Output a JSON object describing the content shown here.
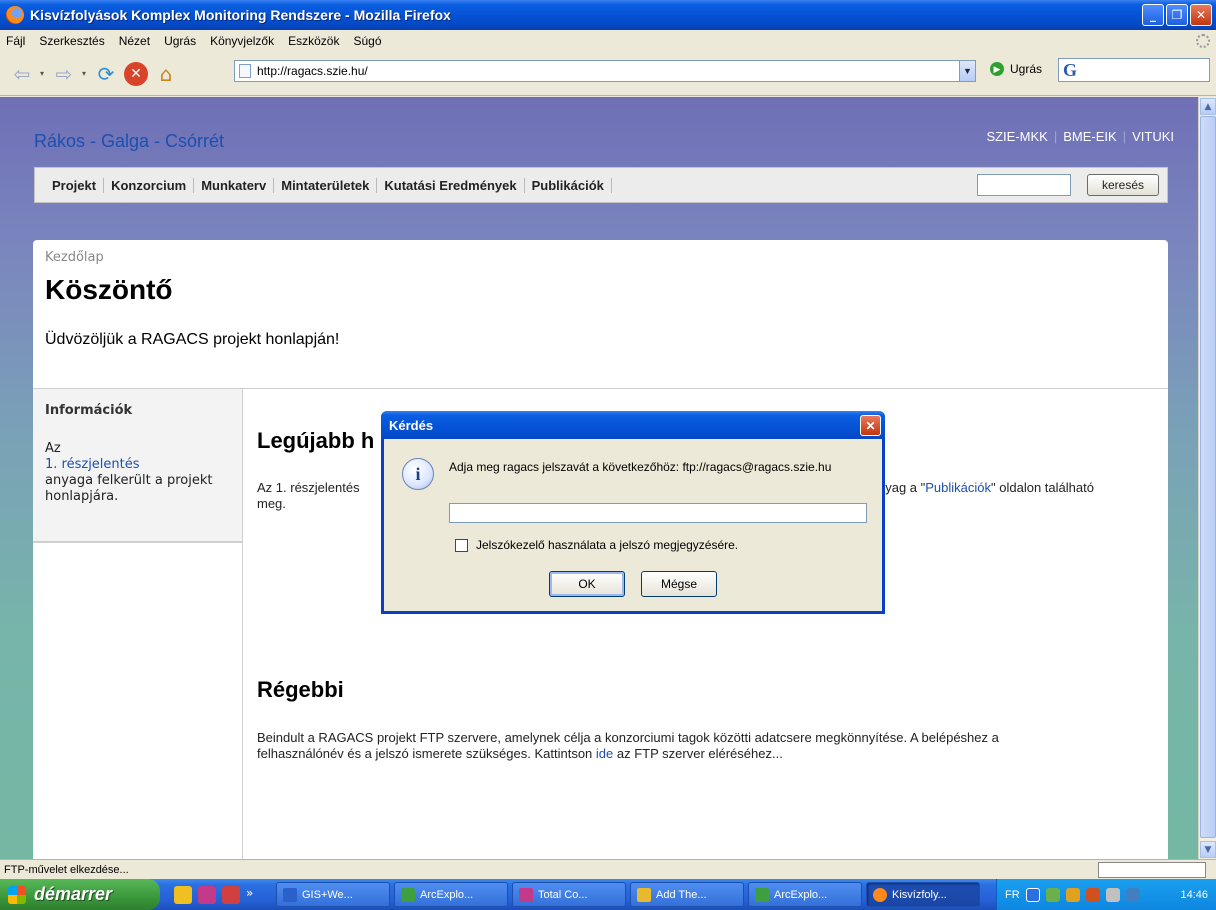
{
  "window": {
    "title": "Kisvízfolyások Komplex Monitoring Rendszere - Mozilla Firefox"
  },
  "menu": [
    "Fájl",
    "Szerkesztés",
    "Nézet",
    "Ugrás",
    "Könyvjelzők",
    "Eszközök",
    "Súgó"
  ],
  "toolbar": {
    "url": "http://ragacs.szie.hu/",
    "go_label": "Ugrás",
    "search_logo": "G"
  },
  "site": {
    "title": "Rákos - Galga - Csórrét",
    "partners": [
      "SZIE-MKK",
      "BME-EIK",
      "VITUKI"
    ],
    "nav": [
      "Projekt",
      "Konzorcium",
      "Munkaterv",
      "Mintaterületek",
      "Kutatási Eredmények",
      "Publikációk"
    ],
    "search_button": "keresés"
  },
  "page": {
    "breadcrumb": "Kezdőlap",
    "heading": "Köszöntő",
    "welcome": "Üdvözöljük a RAGACS projekt honlapján!",
    "sidebar": {
      "title": "Információk",
      "text_before": "Az",
      "link": "1. részjelentés",
      "text_after": "anyaga felkerült a projekt honlapjára."
    },
    "latest": {
      "heading": "Legújabb h",
      "text_start": "Az 1. részjelentés",
      "text_end_pre": "nyag a \"",
      "link": "Publikációk",
      "text_end_post": "\" oldalon található",
      "text_line2": "meg."
    },
    "older": {
      "heading": "Régebbi",
      "text_line1": "Beindult a RAGACS projekt FTP szervere, amelynek célja a konzorciumi tagok közötti adatcsere megkönnyítése. A belépéshez a",
      "text_line2_pre": "felhasználónév és a jelszó ismerete szükséges. Kattintson ",
      "link": "ide",
      "text_line2_post": " az FTP szerver eléréséhez..."
    }
  },
  "dialog": {
    "title": "Kérdés",
    "message": "Adja meg ragacs jelszavát a következőhöz: ftp://ragacs@ragacs.szie.hu",
    "password_value": "",
    "checkbox_label": "Jelszókezelő használata a jelszó megjegyzésére.",
    "checkbox_checked": false,
    "ok": "OK",
    "cancel": "Mégse"
  },
  "status": {
    "text": "FTP-művelet elkezdése..."
  },
  "taskbar": {
    "start": "démarrer",
    "more": "»",
    "tasks": [
      {
        "label": "GIS+We...",
        "color": "#2b5fc9"
      },
      {
        "label": "ArcExplo...",
        "color": "#3f9e3f"
      },
      {
        "label": "Total Co...",
        "color": "#c43a8a"
      },
      {
        "label": "Add The...",
        "color": "#e6b92f"
      },
      {
        "label": "ArcExplo...",
        "color": "#3f9e3f"
      },
      {
        "label": "Kisvízfoly...",
        "color": "#ff8a1c"
      }
    ],
    "lang": "FR",
    "clock": "14:46"
  }
}
